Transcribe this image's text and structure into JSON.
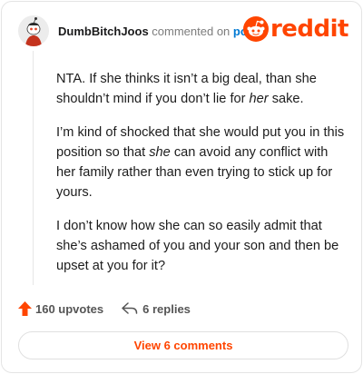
{
  "header": {
    "username": "DumbBitchJoos",
    "action": "commented on",
    "post_link": "post",
    "logo_text": "reddit"
  },
  "comment": {
    "p1_before": "NTA. If she thinks it isn’t a big deal, than she shouldn’t mind if you don’t lie for ",
    "p1_em": "her",
    "p1_after": " sake.",
    "p2_before": "I’m kind of shocked that she would put you in this position so that ",
    "p2_em": "she",
    "p2_after": " can avoid any conflict with her family rather than even trying to stick up for yours.",
    "p3": "I don’t know how she can so easily admit that she’s ashamed of you and your son and then be upset at you for it?"
  },
  "actions": {
    "upvotes": "160 upvotes",
    "replies": "6 replies"
  },
  "view_button": "View 6 comments",
  "colors": {
    "brand": "#ff4500",
    "link": "#0079d3",
    "muted": "#7c7c7c"
  },
  "icons": {
    "logo": "reddit-snoo-icon",
    "upvote": "upvote-arrow-icon",
    "reply": "reply-arrow-icon"
  }
}
